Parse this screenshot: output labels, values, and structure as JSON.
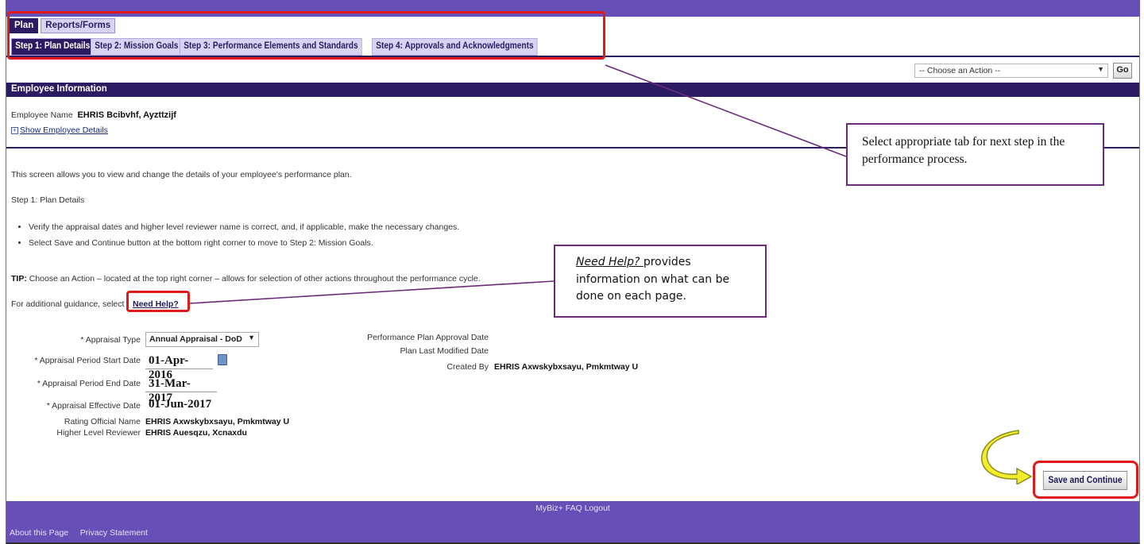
{
  "header": {
    "util_text": "MyBiz+ FAQ Logout"
  },
  "tabs_level1": [
    {
      "label": "Plan",
      "active": true
    },
    {
      "label": "Reports/Forms",
      "active": false
    }
  ],
  "tabs_level2": [
    {
      "label": "Step 1: Plan Details",
      "active": true
    },
    {
      "label": "Step 2: Mission Goals",
      "active": false
    },
    {
      "label": "Step 3: Performance Elements and Standards",
      "active": false
    },
    {
      "label": "Step 4: Approvals and Acknowledgments",
      "active": false
    }
  ],
  "action": {
    "placeholder": "-- Choose an Action --",
    "go_label": "Go"
  },
  "employee_section": {
    "title": "Employee Information",
    "name_label": "Employee Name",
    "name_value": "EHRIS Bcibvhf, Ayzttzijf",
    "show_details": "Show Employee Details"
  },
  "instructions": {
    "intro": "This screen allows you to view and change the details of your employee's performance plan.",
    "step_title": "Step 1: Plan Details",
    "bullets": [
      "Verify the appraisal dates and higher level reviewer name is correct, and, if applicable, make the necessary changes.",
      "Select Save and Continue button at the bottom right corner to move to Step 2: Mission Goals."
    ],
    "tip_label": "TIP:",
    "tip_text": " Choose an Action – located at the top right corner – allows for selection of other actions throughout the performance cycle.",
    "guidance_text": "For additional guidance, select",
    "help_link": "Need Help?"
  },
  "form": {
    "appraisal_type_label": "* Appraisal Type",
    "appraisal_type_value": "Annual Appraisal - DoD",
    "start_label": "* Appraisal Period Start Date",
    "start_value": "01-Apr-2016",
    "end_label": "* Appraisal Period End Date",
    "end_value": "31-Mar-2017",
    "effective_label": "* Appraisal Effective Date",
    "effective_value": "01-Jun-2017",
    "rating_label": "Rating Official Name",
    "rating_value": "EHRIS Axwskybxsayu, Pmkmtway U",
    "reviewer_label": "Higher Level Reviewer",
    "reviewer_value": "EHRIS Auesqzu, Xcnaxdu",
    "approval_label": "Performance Plan Approval Date",
    "modified_label": "Plan Last Modified Date",
    "created_label": "Created By",
    "created_value": "EHRIS Axwskybxsayu, Pmkmtway U"
  },
  "annotations": {
    "tab_note": "Select appropriate tab  for next step in the performance process.",
    "help_note_em": "Need Help? ",
    "help_note_rest": "provides information on what can be done on each page."
  },
  "buttons": {
    "save_continue": "Save and Continue"
  },
  "footer": {
    "center": "MyBiz+  FAQ  Logout",
    "about": "About this Page",
    "privacy": "Privacy Statement"
  }
}
